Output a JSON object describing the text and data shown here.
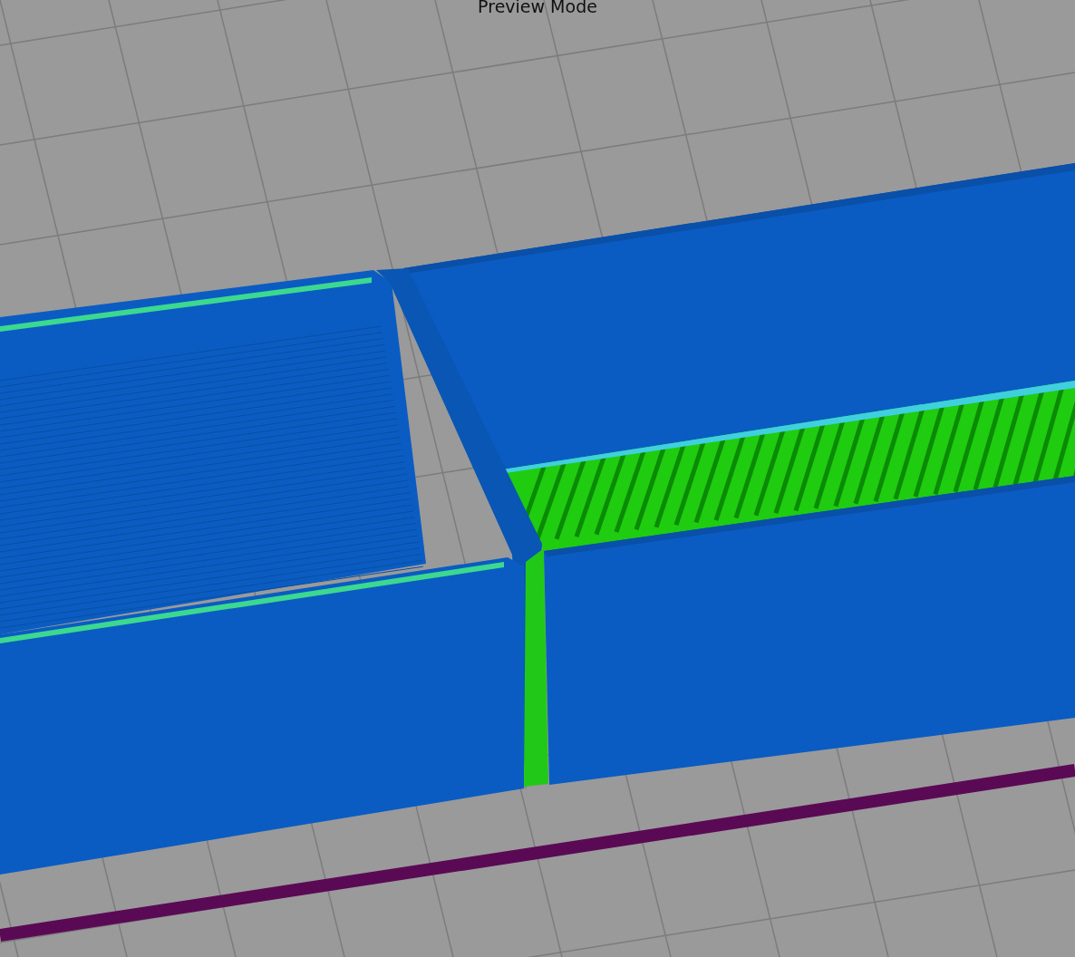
{
  "title": "Preview Mode"
}
